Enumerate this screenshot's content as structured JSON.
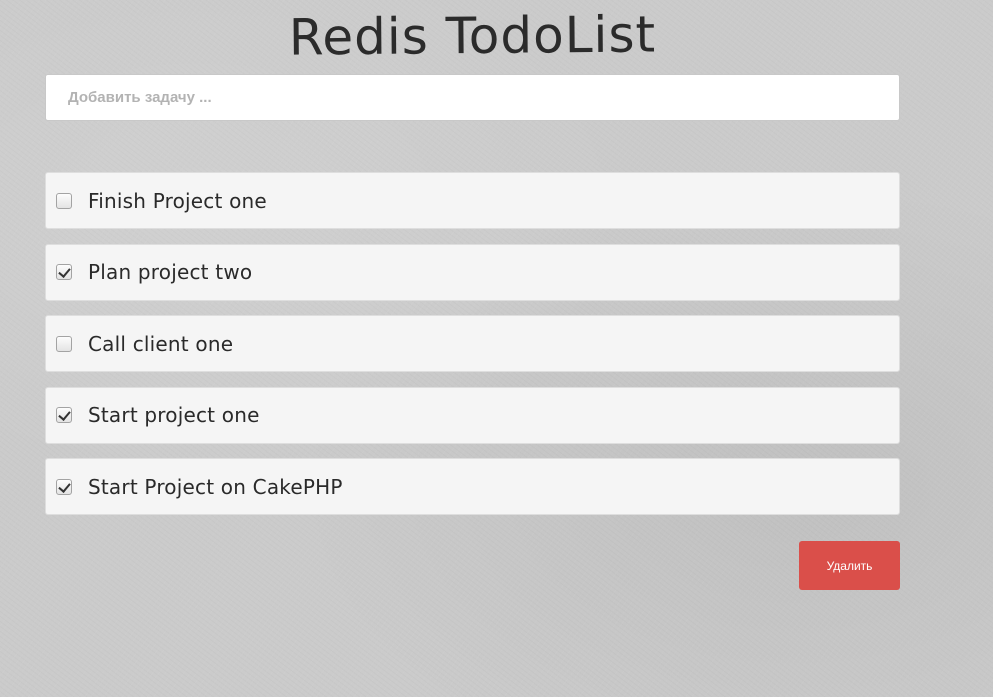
{
  "app": {
    "title": "Redis TodoList"
  },
  "new_task": {
    "placeholder": "Добавить задачу ...",
    "value": ""
  },
  "todos": [
    {
      "text": "Finish Project one",
      "checked": false
    },
    {
      "text": "Plan project two",
      "checked": true
    },
    {
      "text": "Call client one",
      "checked": false
    },
    {
      "text": "Start project one",
      "checked": true
    },
    {
      "text": "Start Project on CakePHP",
      "checked": true
    }
  ],
  "actions": {
    "delete_label": "Удалить"
  },
  "colors": {
    "background": "#cbcbcb",
    "item_background": "#f5f5f5",
    "delete_button": "#da4f4a"
  }
}
